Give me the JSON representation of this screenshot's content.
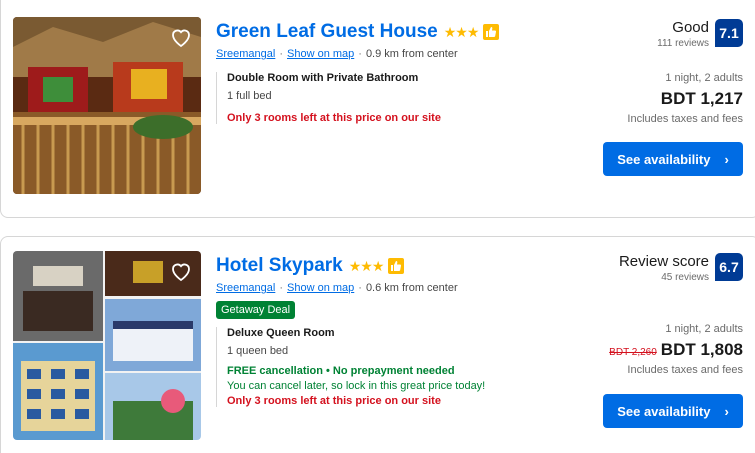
{
  "properties": [
    {
      "name": "Green Leaf Guest House",
      "stars": "★★★",
      "area": "Sreemangal",
      "map_link": "Show on map",
      "distance": "0.9 km from center",
      "room_name": "Double Room with Private Bathroom",
      "bed": "1 full bed",
      "rooms_left": "Only 3 rooms left at this price on our site",
      "review_word": "Good",
      "review_count": "111 reviews",
      "score": "7.1",
      "stay_info": "1 night, 2 adults",
      "price": "BDT 1,217",
      "taxes": "Includes taxes and fees",
      "cta": "See availability"
    },
    {
      "name": "Hotel Skypark",
      "stars": "★★★",
      "area": "Sreemangal",
      "map_link": "Show on map",
      "distance": "0.6 km from center",
      "deal": "Getaway Deal",
      "room_name": "Deluxe Queen Room",
      "bed": "1 queen bed",
      "free_cancel": "FREE cancellation • No prepayment needed",
      "cancel_later": "You can cancel later, so lock in this great price today!",
      "rooms_left": "Only 3 rooms left at this price on our site",
      "review_word": "Review score",
      "review_count": "45 reviews",
      "score": "6.7",
      "stay_info": "1 night, 2 adults",
      "old_price": "BDT 2,260",
      "price": "BDT 1,808",
      "taxes": "Includes taxes and fees",
      "cta": "See availability"
    }
  ],
  "icons": {
    "favorite": "heart-icon",
    "preferred": "thumbs-up-icon",
    "button_arrow": "chevron-right-icon"
  },
  "colors": {
    "link": "#006ce4",
    "score_bg": "#003b95",
    "stars": "#febb02",
    "deal_green": "#008234",
    "urgency_red": "#d4111e"
  }
}
